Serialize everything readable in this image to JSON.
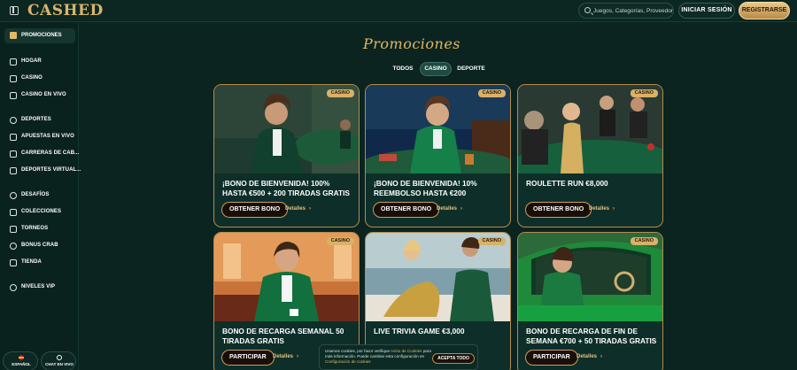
{
  "header": {
    "logo": "CASHED",
    "search_placeholder": "Juegos, Categorías, Proveedores",
    "login_label": "INICIAR SESIÓN",
    "register_label": "REGISTRARSE"
  },
  "sidebar": {
    "promo_label": "PROMOCIONES",
    "items": [
      {
        "label": "HOGAR",
        "icon": "home-icon"
      },
      {
        "label": "CASINO",
        "icon": "cards-icon"
      },
      {
        "label": "CASINO EN VIVO",
        "icon": "live-casino-icon"
      },
      {
        "label": "DEPORTES",
        "icon": "sports-ball-icon"
      },
      {
        "label": "APUESTAS EN VIVO",
        "icon": "live-bet-icon"
      },
      {
        "label": "CARRERAS DE CAB...",
        "icon": "horse-icon"
      },
      {
        "label": "DEPORTES VIRTUAL...",
        "icon": "virtual-sports-icon"
      },
      {
        "label": "DESAFÍOS",
        "icon": "challenge-icon"
      },
      {
        "label": "COLECCIONES",
        "icon": "collection-icon"
      },
      {
        "label": "TORNEOS",
        "icon": "trophy-icon"
      },
      {
        "label": "BONUS CRAB",
        "icon": "crab-icon"
      },
      {
        "label": "TIENDA",
        "icon": "shop-icon"
      },
      {
        "label": "NIVELES VIP",
        "icon": "vip-icon"
      }
    ],
    "language_label": "ESPAÑOL",
    "chat_label": "CHAT EN VIVO"
  },
  "main": {
    "title": "Promociones",
    "tabs": [
      {
        "label": "TODOS",
        "active": false
      },
      {
        "label": "CASINO",
        "active": true
      },
      {
        "label": "DEPORTE",
        "active": false
      }
    ],
    "cards": [
      {
        "badge": "CASINO",
        "title": "¡BONO DE BIENVENIDA! 100% HASTA €500 + 200 TIRADAS GRATIS",
        "button": "OBTENER BONO",
        "details": "Detalles"
      },
      {
        "badge": "CASINO",
        "title": "¡BONO DE BIENVENIDA! 10% REEMBOLSO HASTA €200",
        "button": "OBTENER BONO",
        "details": "Detalles"
      },
      {
        "badge": "CASINO",
        "title": "ROULETTE RUN €8,000",
        "button": "OBTENER BONO",
        "details": "Detalles"
      },
      {
        "badge": "CASINO",
        "title": "BONO DE RECARGA SEMANAL 50 TIRADAS GRATIS",
        "button": "PARTICIPAR",
        "details": "Detalles"
      },
      {
        "badge": "CASINO",
        "title": "LIVE TRIVIA GAME €3,000",
        "button": "",
        "details": ""
      },
      {
        "badge": "CASINO",
        "title": "BONO DE RECARGA DE FIN DE SEMANA €700 + 50 TIRADAS GRATIS",
        "button": "PARTICIPAR",
        "details": "Detalles"
      }
    ]
  },
  "cookie": {
    "line1": "Usamos cookies, por favor verifique ",
    "link1": "Aviso de Cookies",
    "line2": " para más información. Puede cambiar esta configuración en ",
    "link2": "Configuración de cookies",
    "accept": "ACEPTA TODO"
  },
  "colors": {
    "background": "#0b2420",
    "accent_gold": "#e0b865",
    "card_border": "#b48c4c"
  }
}
